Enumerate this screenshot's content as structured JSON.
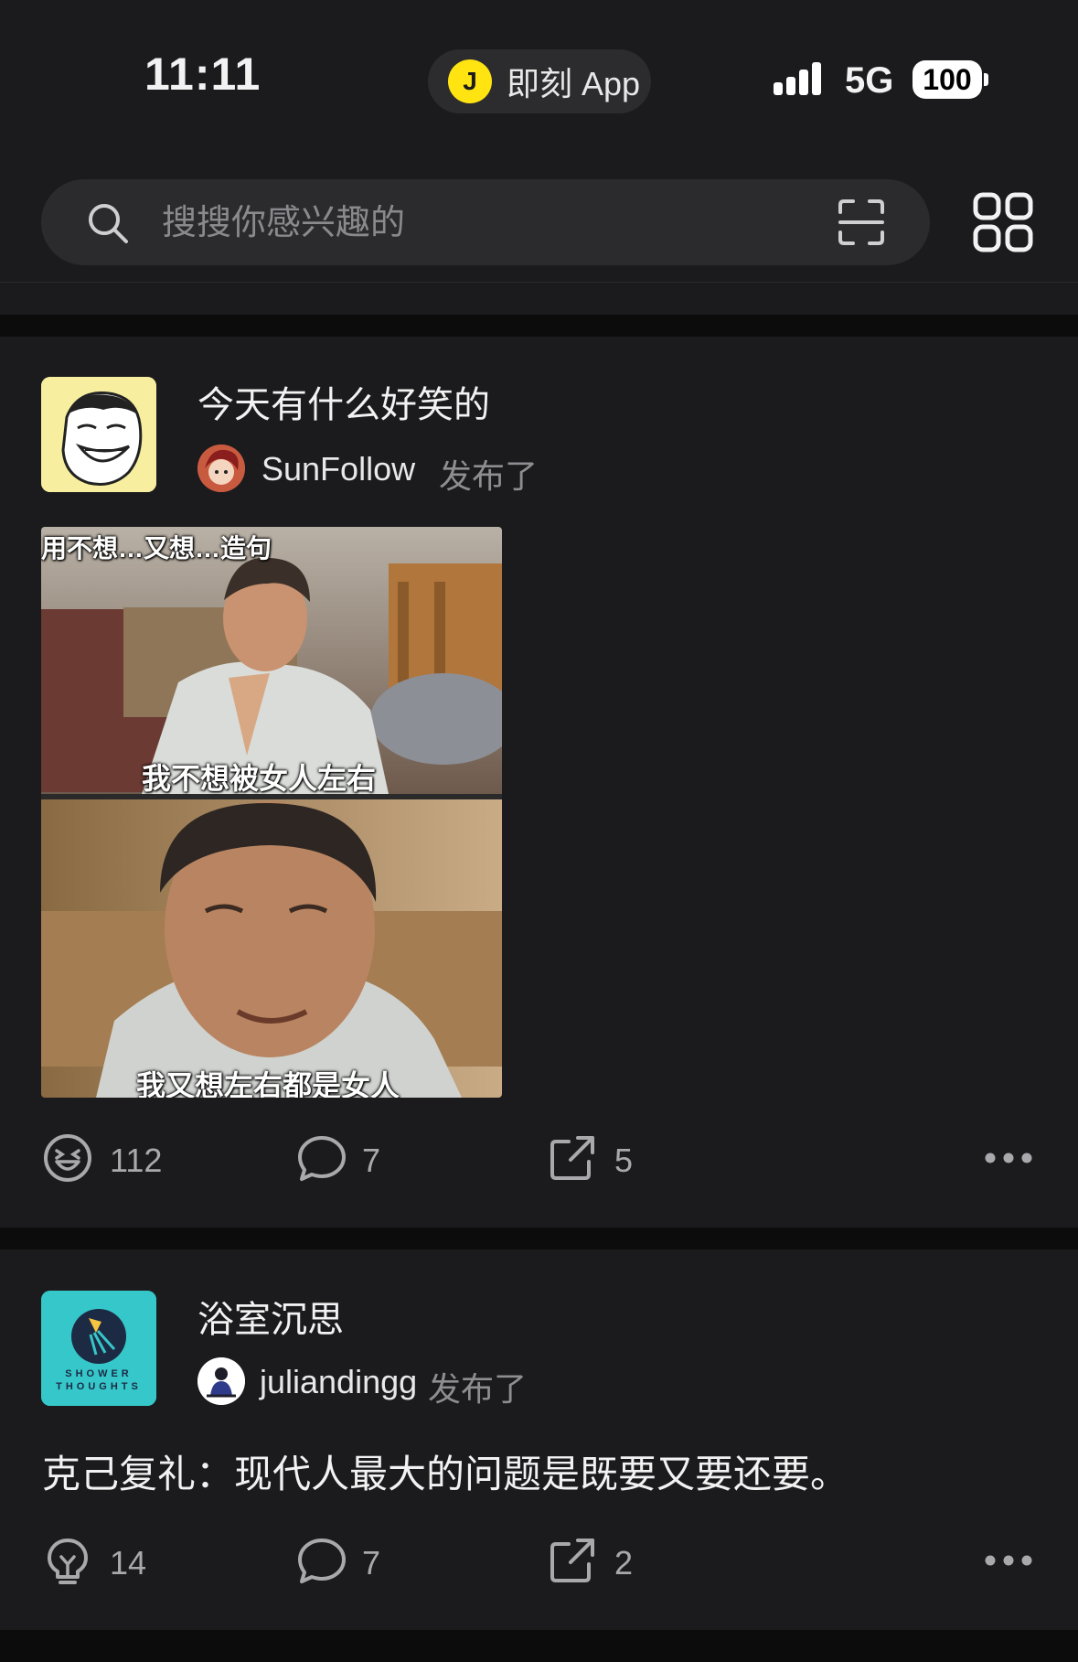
{
  "status_bar": {
    "time": "11:11",
    "app_pill": {
      "logo_char": "J",
      "label": "即刻 App"
    },
    "network": "5G",
    "battery": "100"
  },
  "search": {
    "placeholder": "搜搜你感兴趣的"
  },
  "posts": [
    {
      "topic": "今天有什么好笑的",
      "username": "SunFollow",
      "action": "发布了",
      "image": {
        "top_caption": "用不想…又想…造句",
        "caption_1": "我不想被女人左右",
        "caption_2": "我又想左右都是女人"
      },
      "stats": {
        "likes": "112",
        "comments": "7",
        "shares": "5"
      }
    },
    {
      "topic": "浴室沉思",
      "topic_logo_text": "SHOWER THOUGHTS",
      "username": "juliandingg",
      "action": "发布了",
      "text": "克己复礼：现代人最大的问题是既要又要还要。",
      "stats": {
        "likes": "14",
        "comments": "7",
        "shares": "2"
      }
    }
  ],
  "colors": {
    "background": "#1b1b1d",
    "separator": "#0c0c0c",
    "brand_yellow": "#ffe411",
    "shower_teal": "#35c7c9"
  }
}
